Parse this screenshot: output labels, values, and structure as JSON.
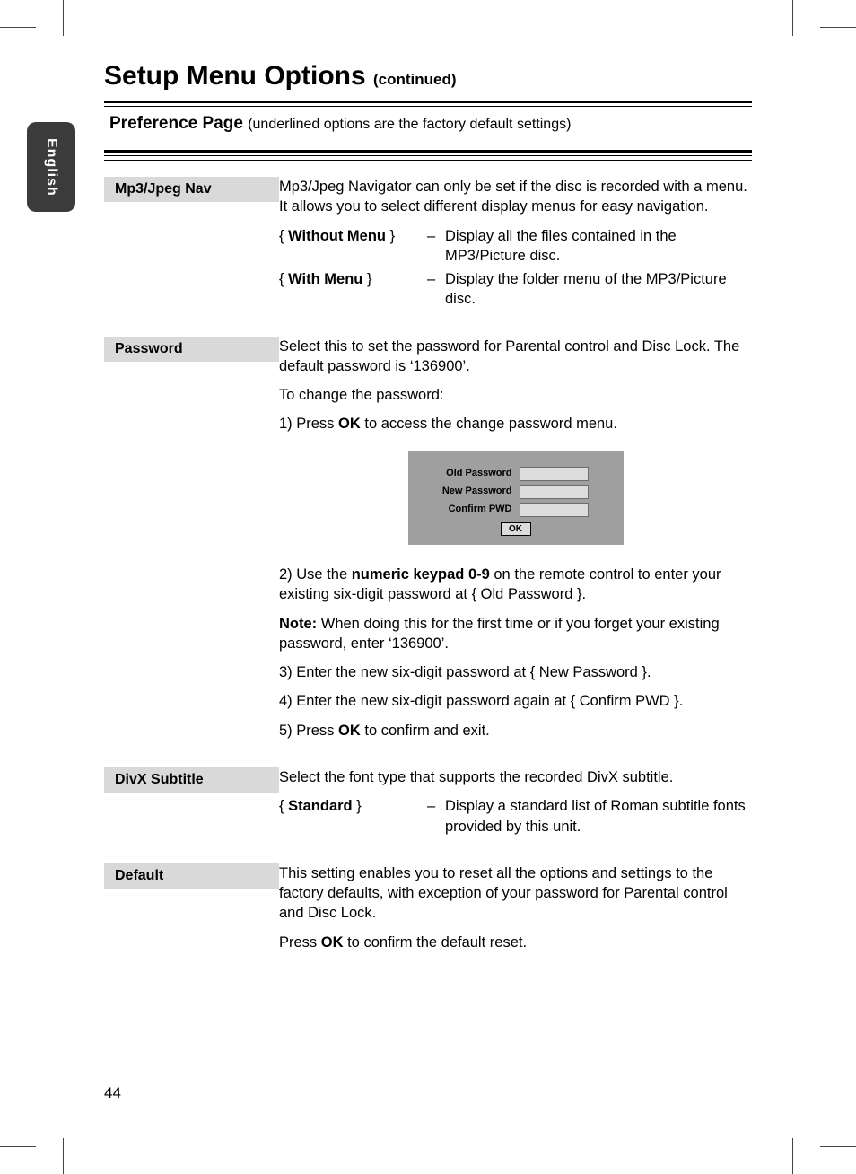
{
  "language_tab": "English",
  "heading_main": "Setup Menu Options",
  "heading_cont": "(continued)",
  "pref_header_bold": "Preference Page",
  "pref_header_note": "(underlined options are the factory default settings)",
  "mp3": {
    "label": "Mp3/Jpeg Nav",
    "intro": "Mp3/Jpeg Navigator can only be set if the disc is recorded with a menu. It allows you to select different display menus for easy navigation.",
    "opt1_name": "Without Menu",
    "opt1_desc": "Display all the files contained in the MP3/Picture disc.",
    "opt2_name": "With Menu",
    "opt2_desc": "Display the folder menu of the MP3/Picture disc."
  },
  "password": {
    "label": "Password",
    "intro": "Select this to set the password for Parental control and Disc Lock. The default password is ‘136900’.",
    "to_change": "To change the password:",
    "step1_a": "1)  Press ",
    "step1_ok": "OK",
    "step1_b": " to access the change password menu.",
    "dlg_old": "Old  Password",
    "dlg_new": "New Password",
    "dlg_conf": "Confirm PWD",
    "dlg_ok": "OK",
    "step2_a": "2)  Use the ",
    "step2_kp": "numeric keypad 0-9",
    "step2_b": " on the remote control to enter your existing six-digit password at { Old Password }.",
    "note_bold": "Note:",
    "note_body": "  When doing this for the first time or if you forget your existing password, enter ‘136900’.",
    "step3": "3)  Enter the new six-digit password at { New Password }.",
    "step4": "4)  Enter the new six-digit password again at { Confirm PWD }.",
    "step5_a": "5)  Press ",
    "step5_ok": "OK",
    "step5_b": " to confirm and exit."
  },
  "divx": {
    "label": "DivX Subtitle",
    "intro": "Select the font type that supports the recorded DivX subtitle.",
    "opt_name": "Standard",
    "opt_desc": "Display a standard list of Roman subtitle fonts provided by this unit."
  },
  "def": {
    "label": "Default",
    "intro": "This setting enables you to reset all the options and settings to the factory defaults, with exception of your password for Parental control and Disc Lock.",
    "press_a": "Press ",
    "press_ok": "OK",
    "press_b": " to confirm the default reset."
  },
  "page_number": "44"
}
